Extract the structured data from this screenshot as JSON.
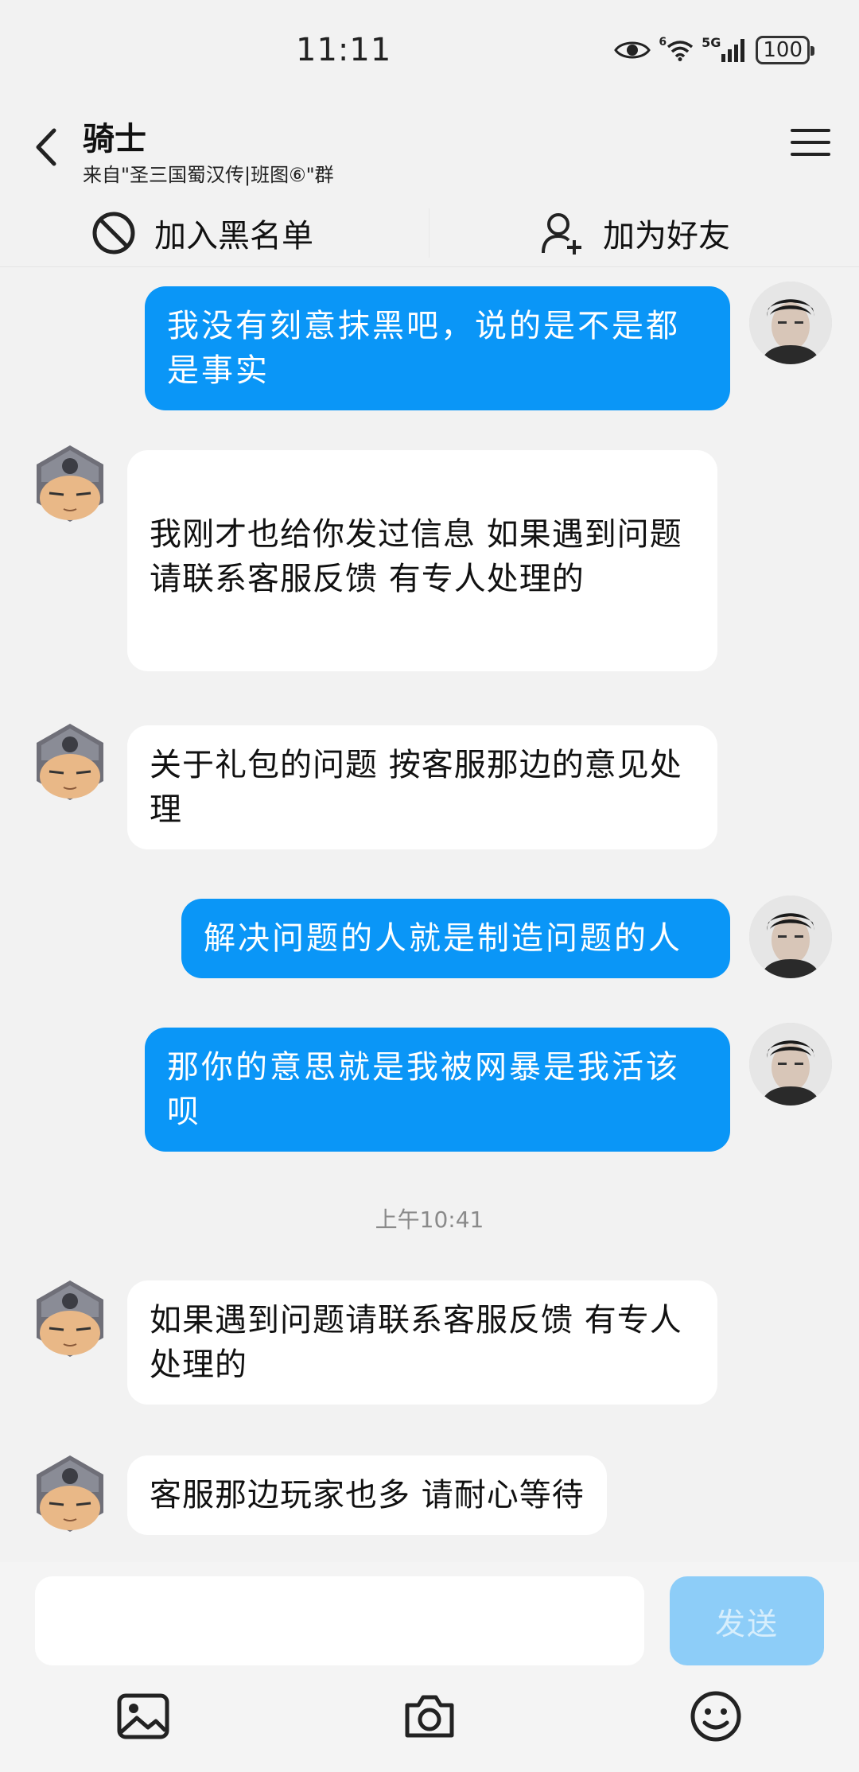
{
  "status_bar": {
    "time": "11:11",
    "signal_label": "5G",
    "wifi_label": "6",
    "battery": "100"
  },
  "header": {
    "title": "骑士",
    "subtitle": "来自\"圣三国蜀汉传|班图⑥\"群"
  },
  "actions": {
    "blacklist_label": "加入黑名单",
    "add_friend_label": "加为好友"
  },
  "messages": [
    {
      "from": "me",
      "text": "我没有刻意抹黑吧，说的是不是都是事实"
    },
    {
      "from": "other",
      "text": "我刚才也给你发过信息    如果遇到问题请联系客服反馈  有专人处理的"
    },
    {
      "from": "other",
      "text": "关于礼包的问题   按客服那边的意见处理"
    },
    {
      "from": "me",
      "text": "解决问题的人就是制造问题的人"
    },
    {
      "from": "me",
      "text": "那你的意思就是我被网暴是我活该呗"
    },
    {
      "from": "other",
      "text": "如果遇到问题请联系客服反馈  有专人处理的"
    },
    {
      "from": "other",
      "text": "客服那边玩家也多  请耐心等待"
    }
  ],
  "timestamp": "上午10:41",
  "input": {
    "placeholder": "",
    "send_label": "发送"
  },
  "colors": {
    "my_bubble": "#0a96f7",
    "other_bubble": "#ffffff",
    "background": "#f2f2f2",
    "send_button": "#8dcdf8"
  },
  "icons": {
    "back": "back-arrow-icon",
    "menu": "menu-icon",
    "blacklist": "block-icon",
    "add_friend": "add-user-icon",
    "image": "image-icon",
    "camera": "camera-icon",
    "emoji": "emoji-icon"
  }
}
